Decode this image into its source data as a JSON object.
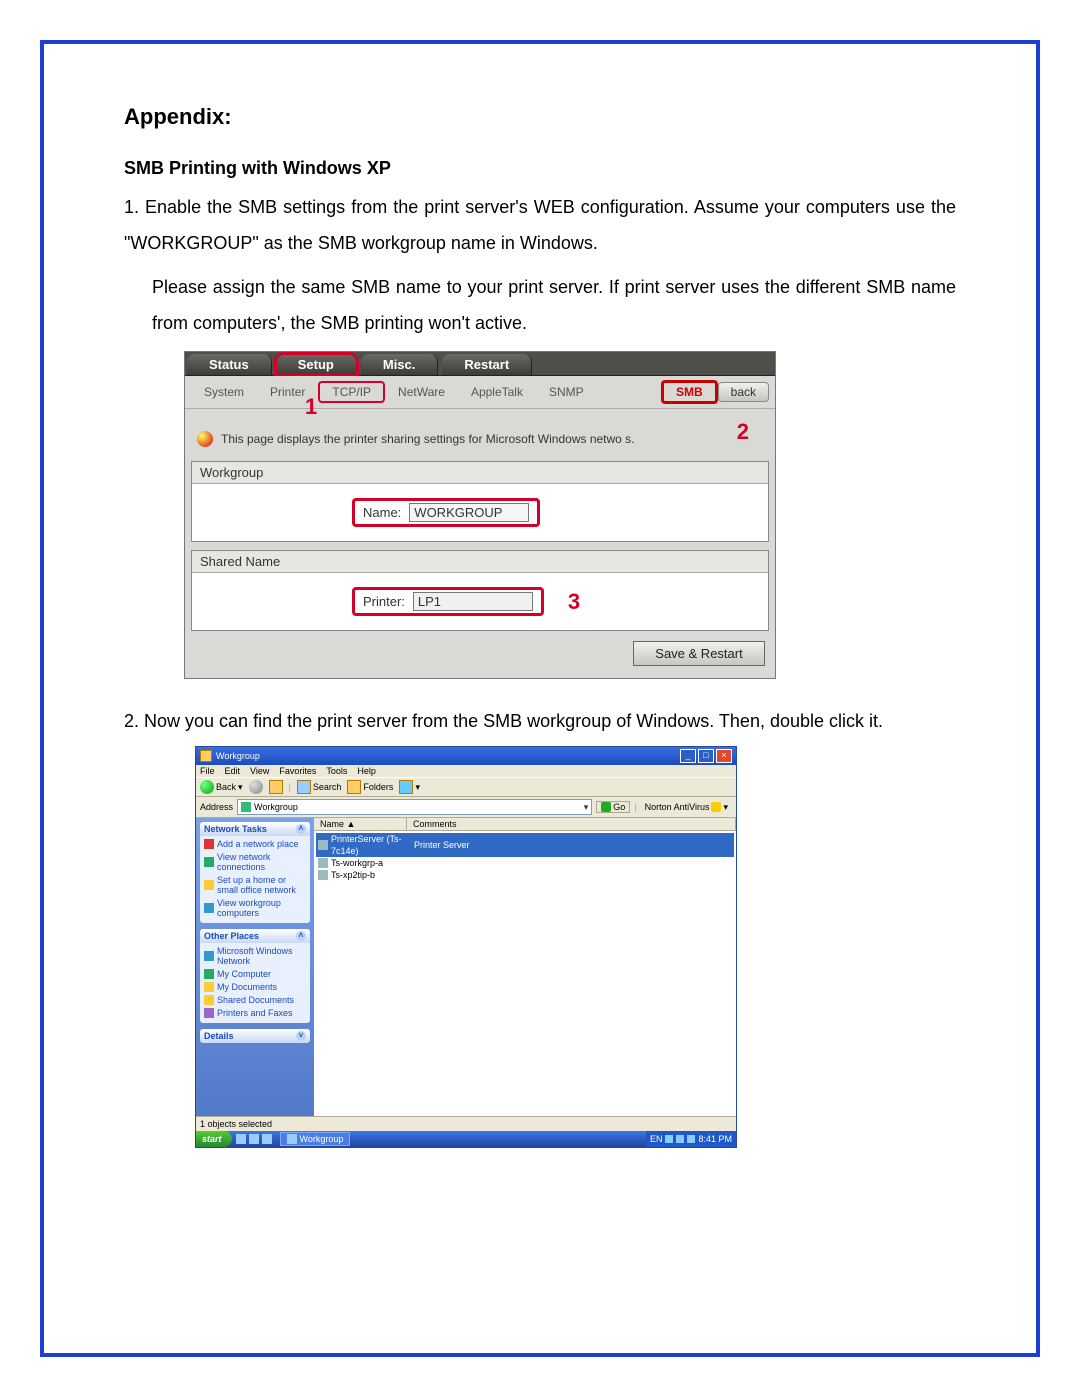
{
  "doc": {
    "heading": "Appendix:",
    "subheading": "SMB Printing with Windows XP",
    "step1_lead": "1. ",
    "step1_a": "Enable the SMB settings from the print server's WEB configuration. Assume your computers use the \"WORKGROUP\" as the SMB workgroup name in Windows.",
    "step1_b": "Please assign the same SMB name to your print server. If print server uses the different SMB name from computers', the SMB printing won't active.",
    "step2_lead": "2. ",
    "step2": "Now you can find the print server from the SMB workgroup of Windows. Then, double click it."
  },
  "shot1": {
    "tabs_top": {
      "status": "Status",
      "setup": "Setup",
      "misc": "Misc.",
      "restart": "Restart"
    },
    "tabs_sub": {
      "system": "System",
      "printer": "Printer",
      "tcpip": "TCP/IP",
      "netware": "NetWare",
      "appletalk": "AppleTalk",
      "snmp": "SNMP",
      "smb": "SMB",
      "back": "back"
    },
    "callouts": {
      "one": "1",
      "two": "2",
      "three": "3"
    },
    "info_line": "This page displays the printer sharing settings for Microsoft Windows netwo   s.",
    "panel_workgroup": {
      "title": "Workgroup",
      "name_label": "Name:",
      "name_value": "WORKGROUP"
    },
    "panel_shared": {
      "title": "Shared Name",
      "printer_label": "Printer:",
      "printer_value": "LP1"
    },
    "save_btn": "Save & Restart"
  },
  "shot2": {
    "title": "Workgroup",
    "menu": {
      "file": "File",
      "edit": "Edit",
      "view": "View",
      "favorites": "Favorites",
      "tools": "Tools",
      "help": "Help"
    },
    "toolbar": {
      "back": "Back",
      "search": "Search",
      "folders": "Folders"
    },
    "address_label": "Address",
    "address_value": "Workgroup",
    "go": "Go",
    "norton": "Norton AntiVirus",
    "side_network": {
      "title": "Network Tasks",
      "items": [
        "Add a network place",
        "View network connections",
        "Set up a home or small office network",
        "View workgroup computers"
      ]
    },
    "side_other": {
      "title": "Other Places",
      "items": [
        "Microsoft Windows Network",
        "My Computer",
        "My Documents",
        "Shared Documents",
        "Printers and Faxes"
      ]
    },
    "side_details": {
      "title": "Details"
    },
    "cols": {
      "name": "Name  ▲",
      "comments": "Comments"
    },
    "rows": [
      {
        "name": "PrinterServer (Ts-7c14e)",
        "comment": "Printer Server",
        "sel": true
      },
      {
        "name": "Ts-workgrp-a",
        "comment": "",
        "sel": false
      },
      {
        "name": "Ts-xp2tip-b",
        "comment": "",
        "sel": false
      }
    ],
    "status": "1 objects selected",
    "taskbar": {
      "start": "start",
      "task": "Workgroup",
      "lang": "EN",
      "clock": "8:41 PM"
    }
  }
}
